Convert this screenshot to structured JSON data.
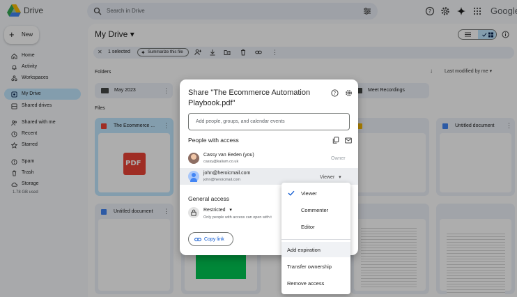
{
  "app": {
    "name": "Drive",
    "brand": "Google"
  },
  "search": {
    "placeholder": "Search in Drive"
  },
  "sidebar": {
    "new_label": "New",
    "items": [
      {
        "label": "Home",
        "icon": "home-icon"
      },
      {
        "label": "Activity",
        "icon": "bell-icon"
      },
      {
        "label": "Workspaces",
        "icon": "workspaces-icon"
      },
      {
        "label": "My Drive",
        "icon": "my-drive-icon",
        "active": true
      },
      {
        "label": "Shared drives",
        "icon": "shared-drives-icon"
      },
      {
        "label": "Shared with me",
        "icon": "people-icon"
      },
      {
        "label": "Recent",
        "icon": "clock-icon"
      },
      {
        "label": "Starred",
        "icon": "star-icon"
      },
      {
        "label": "Spam",
        "icon": "spam-icon"
      },
      {
        "label": "Trash",
        "icon": "trash-icon"
      },
      {
        "label": "Storage",
        "icon": "cloud-icon"
      }
    ],
    "storage_used": "1.78 GB used"
  },
  "main": {
    "title": "My Drive",
    "selection": {
      "count_label": "1 selected",
      "summarize_label": "Summarize this file"
    },
    "folders_label": "Folders",
    "sort_label": "Last modified by me",
    "folders": [
      {
        "name": "May 2023"
      },
      {
        "name": "Meet Recordings"
      }
    ],
    "files_label": "Files",
    "files": [
      {
        "name": "The Ecommerce ...",
        "type": "pdf"
      },
      {
        "name": "Untitled document",
        "type": "doc"
      },
      {
        "name": "Untitled document",
        "type": "doc"
      }
    ]
  },
  "share_dialog": {
    "title": "Share \"The Ecommerce Automation Playbook.pdf\"",
    "input_placeholder": "Add people, groups, and calendar events",
    "people_heading": "People with access",
    "people": [
      {
        "name": "Cassy van Eeden (you)",
        "email": "cassy@kalium.co.uk",
        "role": "Owner"
      },
      {
        "name": "john@heroicmail.com",
        "email": "john@heroicmail.com",
        "role": "Viewer"
      }
    ],
    "general_heading": "General access",
    "access_level": "Restricted",
    "access_desc": "Only people with access can open with t",
    "copy_link_label": "Copy link"
  },
  "role_menu": {
    "items": [
      "Viewer",
      "Commenter",
      "Editor"
    ],
    "selected": "Viewer",
    "actions": [
      "Add expiration",
      "Transfer ownership",
      "Remove access"
    ]
  },
  "colors": {
    "accent": "#0b57d0",
    "active_nav": "#c2e7ff",
    "pdf_red": "#ea4335",
    "doc_blue": "#4285f4"
  }
}
